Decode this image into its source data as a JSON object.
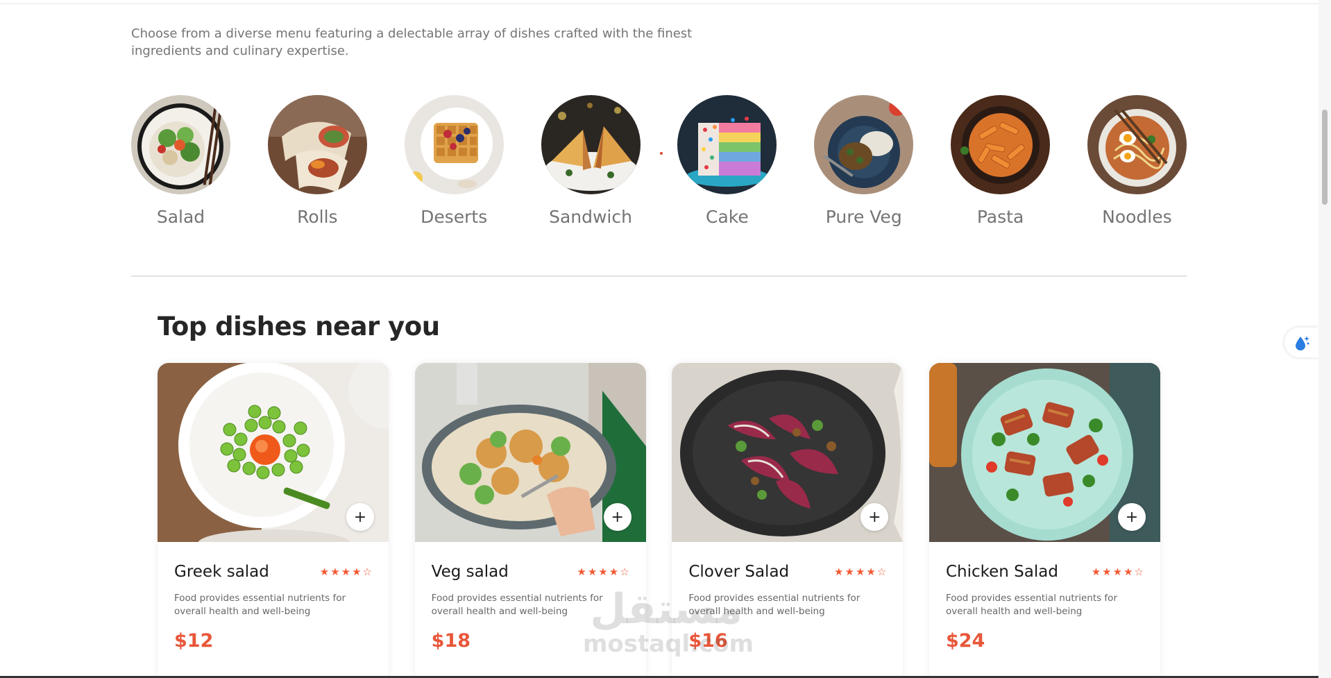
{
  "section": {
    "description": "Choose from a diverse menu featuring a delectable array of dishes crafted with the finest ingredients and culinary expertise."
  },
  "categories": [
    {
      "label": "Salad",
      "icon": "salad-image"
    },
    {
      "label": "Rolls",
      "icon": "rolls-image"
    },
    {
      "label": "Deserts",
      "icon": "deserts-image"
    },
    {
      "label": "Sandwich",
      "icon": "sandwich-image"
    },
    {
      "label": "Cake",
      "icon": "cake-image"
    },
    {
      "label": "Pure Veg",
      "icon": "pure-veg-image"
    },
    {
      "label": "Pasta",
      "icon": "pasta-image"
    },
    {
      "label": "Noodles",
      "icon": "noodles-image"
    }
  ],
  "top_dishes": {
    "title": "Top dishes near you",
    "items": [
      {
        "name": "Greek salad",
        "rating": 4,
        "max_rating": 5,
        "description": "Food provides essential nutrients for overall health and well-being",
        "price": "$12",
        "add_label": "+"
      },
      {
        "name": "Veg salad",
        "rating": 4,
        "max_rating": 5,
        "description": "Food provides essential nutrients for overall health and well-being",
        "price": "$18",
        "add_label": "+"
      },
      {
        "name": "Clover Salad",
        "rating": 4,
        "max_rating": 5,
        "description": "Food provides essential nutrients for overall health and well-being",
        "price": "$16",
        "add_label": "+"
      },
      {
        "name": "Chicken Salad",
        "rating": 4,
        "max_rating": 5,
        "description": "Food provides essential nutrients for overall health and well-being",
        "price": "$24",
        "add_label": "+"
      }
    ]
  },
  "watermark": {
    "arabic": "مستقل",
    "latin": "mostaql.com"
  },
  "colors": {
    "accent": "#e8573a",
    "star": "#f15b34",
    "muted_text": "#747474",
    "heading": "#262626"
  },
  "icons": {
    "star_filled": "★",
    "star_empty": "☆",
    "widget": "water-drop-sparkle-icon"
  }
}
